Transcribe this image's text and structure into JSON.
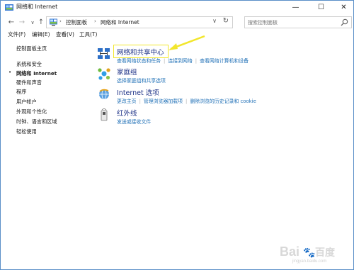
{
  "window": {
    "title": "网络和 Internet"
  },
  "titlebar": {
    "minimize": "—",
    "maximize": "☐",
    "close": "✕"
  },
  "nav": {
    "back": "←",
    "forward": "→",
    "dropdown": "∨",
    "up": "↑"
  },
  "address": {
    "crumbs": [
      "控制面板",
      "网络和 Internet"
    ],
    "separator": "›",
    "dropdown": "∨",
    "refresh": "↻"
  },
  "search": {
    "placeholder": "搜索控制面板"
  },
  "menu": {
    "items": [
      "文件(F)",
      "编辑(E)",
      "查看(V)",
      "工具(T)"
    ]
  },
  "sidebar": {
    "items": [
      {
        "label": "控制面板主页"
      },
      {
        "label": "系统和安全"
      },
      {
        "label": "网络和 Internet"
      },
      {
        "label": "硬件和声音"
      },
      {
        "label": "程序"
      },
      {
        "label": "用户帐户"
      },
      {
        "label": "外观和个性化"
      },
      {
        "label": "时钟、语言和区域"
      },
      {
        "label": "轻松使用"
      }
    ],
    "active_index": 2,
    "bullet": "•"
  },
  "categories": [
    {
      "title": "网络和共享中心",
      "links": [
        "查看网络状态和任务",
        "连接到网络",
        "查看网络计算机和设备"
      ],
      "icon": "network-sharing-icon"
    },
    {
      "title": "家庭组",
      "links": [
        "选择家庭组和共享选项"
      ],
      "icon": "homegroup-icon"
    },
    {
      "title": "Internet 选项",
      "links": [
        "更改主页",
        "管理浏览器加载项",
        "删除浏览的历史记录和 cookie"
      ],
      "icon": "internet-options-icon"
    },
    {
      "title": "红外线",
      "links": [
        "发送或接收文件"
      ],
      "icon": "infrared-icon"
    }
  ],
  "watermark": {
    "brand": "Bai",
    "brand2": "百度",
    "sub": "jingyan.baidu.com"
  },
  "colors": {
    "accent": "#1e3287",
    "link": "#1e6fb6",
    "highlight": "#f2e62c"
  }
}
